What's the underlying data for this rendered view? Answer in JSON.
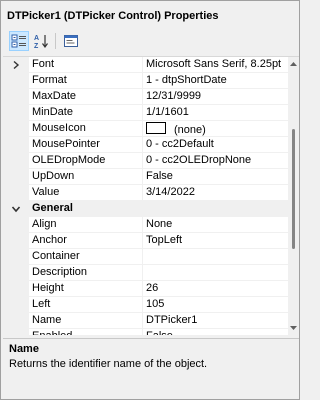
{
  "window": {
    "title": "DTPicker1 (DTPicker Control) Properties"
  },
  "toolbar": {
    "categorized_icon": "categorized-icon",
    "alphabetical_icon": "sort-alphabetical-icon",
    "property_pages_icon": "property-pages-icon"
  },
  "grid": {
    "rows": [
      {
        "name": "Font",
        "value": "Microsoft Sans Serif, 8.25pt"
      },
      {
        "name": "Format",
        "value": "1 - dtpShortDate"
      },
      {
        "name": "MaxDate",
        "value": "12/31/9999"
      },
      {
        "name": "MinDate",
        "value": "1/1/1601"
      },
      {
        "name": "MouseIcon",
        "value": "(none)"
      },
      {
        "name": "MousePointer",
        "value": "0 - cc2Default"
      },
      {
        "name": "OLEDropMode",
        "value": "0 - cc2OLEDropNone"
      },
      {
        "name": "UpDown",
        "value": "False"
      },
      {
        "name": "Value",
        "value": "3/14/2022"
      },
      {
        "category": "General"
      },
      {
        "name": "Align",
        "value": "None"
      },
      {
        "name": "Anchor",
        "value": "TopLeft"
      },
      {
        "name": "Container",
        "value": ""
      },
      {
        "name": "Description",
        "value": ""
      },
      {
        "name": "Height",
        "value": "26"
      },
      {
        "name": "Left",
        "value": "105"
      },
      {
        "name": "Name",
        "value": "DTPicker1"
      },
      {
        "name": "Enabled",
        "value": "False"
      }
    ]
  },
  "description": {
    "title": "Name",
    "text": "Returns the identifier name of the object."
  }
}
